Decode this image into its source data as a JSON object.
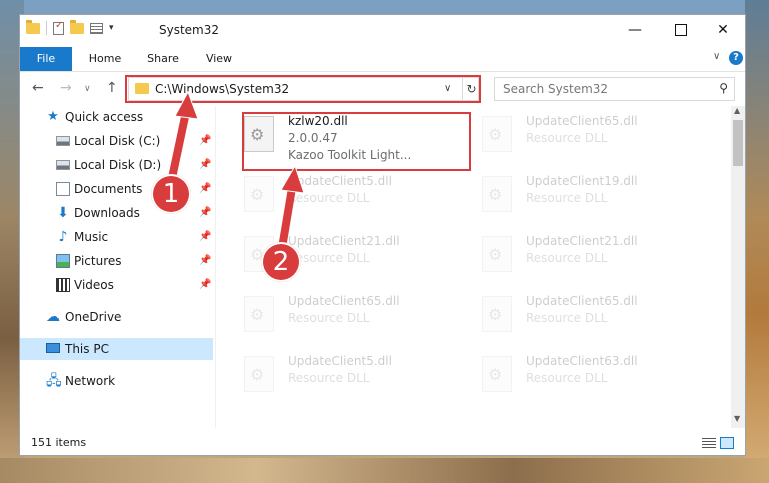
{
  "window": {
    "title": "System32",
    "minimize": "—",
    "close": "✕"
  },
  "ribbon": {
    "tabs": [
      "File",
      "Home",
      "Share",
      "View"
    ],
    "expand": "∨",
    "help": "?"
  },
  "nav": {
    "back": "←",
    "forward": "→",
    "recent": "∨",
    "up": "↑",
    "address": "C:\\Windows\\System32",
    "address_dropdown": "∨",
    "refresh": "↻",
    "search_placeholder": "Search System32",
    "search_glyph": "⚲"
  },
  "sidebar": {
    "pin_glyph": "📌",
    "items": [
      {
        "label": "Quick access",
        "icon": "star-icon",
        "pinned": false
      },
      {
        "label": "Local Disk (C:)",
        "icon": "disk-icon",
        "pinned": true
      },
      {
        "label": "Local Disk (D:)",
        "icon": "disk-icon",
        "pinned": true
      },
      {
        "label": "Documents",
        "icon": "document-icon",
        "pinned": true
      },
      {
        "label": "Downloads",
        "icon": "download-icon",
        "pinned": true
      },
      {
        "label": "Music",
        "icon": "music-icon",
        "pinned": true
      },
      {
        "label": "Pictures",
        "icon": "pictures-icon",
        "pinned": true
      },
      {
        "label": "Videos",
        "icon": "videos-icon",
        "pinned": true
      },
      {
        "label": "OneDrive",
        "icon": "cloud-icon",
        "pinned": false
      },
      {
        "label": "This PC",
        "icon": "pc-icon",
        "pinned": false,
        "selected": true
      },
      {
        "label": "Network",
        "icon": "network-icon",
        "pinned": false
      }
    ]
  },
  "files": [
    {
      "name": "kzlw20.dll",
      "line1": "2.0.0.47",
      "line2": "Kazoo Toolkit Light...",
      "highlighted": true
    },
    {
      "name": "UpdateClient65.dll",
      "line1": "Resource DLL",
      "line2": ""
    },
    {
      "name": "UpdateClient5.dll",
      "line1": "Resource DLL",
      "line2": ""
    },
    {
      "name": "UpdateClient19.dll",
      "line1": "Resource DLL",
      "line2": ""
    },
    {
      "name": "UpdateClient21.dll",
      "line1": "Resource DLL",
      "line2": ""
    },
    {
      "name": "UpdateClient21.dll",
      "line1": "Resource DLL",
      "line2": ""
    },
    {
      "name": "UpdateClient65.dll",
      "line1": "Resource DLL",
      "line2": ""
    },
    {
      "name": "UpdateClient65.dll",
      "line1": "Resource DLL",
      "line2": ""
    },
    {
      "name": "UpdateClient5.dll",
      "line1": "Resource DLL",
      "line2": ""
    },
    {
      "name": "UpdateClient63.dll",
      "line1": "Resource DLL",
      "line2": ""
    }
  ],
  "status": {
    "item_count": "151 items"
  },
  "annotations": {
    "callout_1": "1",
    "callout_2": "2"
  },
  "colors": {
    "accent": "#1979ca",
    "highlight_red": "#d93c3c",
    "selection": "#cce8ff"
  }
}
